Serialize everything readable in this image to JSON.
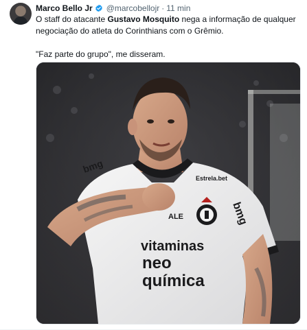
{
  "tweet": {
    "author_name": "Marco Bello Jr",
    "handle": "@marcobellojr",
    "separator": "·",
    "time": "11 min",
    "text_before": "O staff do atacante ",
    "text_bold": "Gustavo Mosquito",
    "text_after": " nega a informação de qualquer negociação do atleta do Corinthians com o Grêmio.",
    "quote": "\"Faz parte do grupo\", me disseram."
  },
  "media": {
    "shirt_sponsor_line1": "vitaminas",
    "shirt_sponsor_line2": "neo",
    "shirt_sponsor_line3": "química",
    "sleeve_sponsor": "bmg",
    "chest_sponsor": "Estrela.bet",
    "brand_mark": "ALE"
  },
  "colors": {
    "verified": "#1d9bf0",
    "text": "#0f1419",
    "secondary": "#536471"
  }
}
